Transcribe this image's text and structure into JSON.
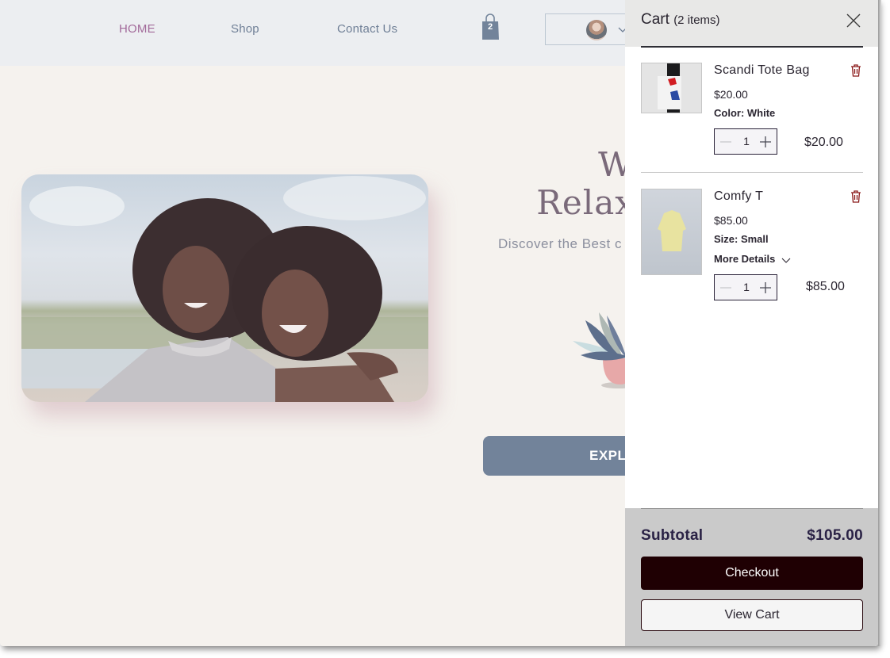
{
  "nav": {
    "items": [
      {
        "label": "HOME",
        "active": true
      },
      {
        "label": "Shop",
        "active": false
      },
      {
        "label": "Contact Us",
        "active": false
      }
    ],
    "cart_icon": "shopping-bag-icon",
    "cart_count": "2",
    "account_icon": "avatar",
    "account_chevron": "chevron-down-icon"
  },
  "hero": {
    "title_line1": "Welco",
    "title_line2": "Relaxed",
    "subtitle": "Discover the Best c",
    "button_label": "EXPL",
    "image_alt": "Two women laughing on a beach"
  },
  "cart": {
    "title": "Cart",
    "item_count_label": "(2 items)",
    "close_icon": "close-icon",
    "items": [
      {
        "name": "Scandi Tote Bag",
        "price": "$20.00",
        "option": "Color: White",
        "quantity": "1",
        "line_total": "$20.00",
        "thumbnail": "tote-bag-image"
      },
      {
        "name": "Comfy T",
        "price": "$85.00",
        "option": "Size: Small",
        "more_details": "More Details",
        "quantity": "1",
        "line_total": "$85.00",
        "thumbnail": "yellow-tshirt-image"
      }
    ],
    "subtotal_label": "Subtotal",
    "subtotal_value": "$105.00",
    "checkout_label": "Checkout",
    "view_cart_label": "View Cart"
  },
  "colors": {
    "nav_active": "#a26a9a",
    "nav_text": "#6f7f96",
    "checkout_bg": "#1f0003",
    "trash": "#8b1a1a",
    "explore_bg": "#72839a"
  }
}
